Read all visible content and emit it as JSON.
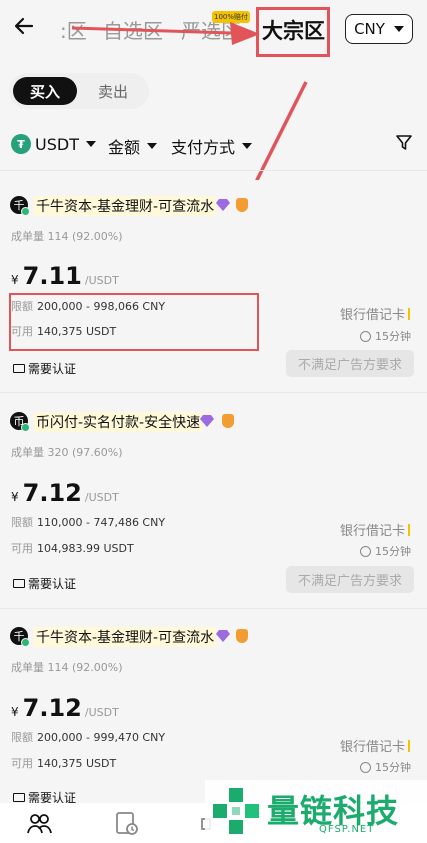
{
  "header": {
    "back_icon": "arrow-left-icon",
    "tabs": [
      {
        "label": ":区",
        "active": false
      },
      {
        "label": "自选区",
        "active": false
      },
      {
        "label": "严选区",
        "active": false
      },
      {
        "label": "大宗区",
        "active": true
      }
    ],
    "badge": "100%赔付",
    "currency": "CNY"
  },
  "trade_toggle": {
    "buy": "买入",
    "sell": "卖出"
  },
  "filters": {
    "coin": "USDT",
    "amount": "金额",
    "payment": "支付方式",
    "filter_icon": "funnel-icon"
  },
  "colors": {
    "accent": "#111111",
    "annotation_red": "#e0545a",
    "online": "#2bb673",
    "usdt": "#26a17b"
  },
  "ads": [
    {
      "avatar_char": "千",
      "merchant": "千牛资本-基金理财-可查流水",
      "stats": "成单量 114 (92.00%)",
      "currency_symbol": "¥",
      "price": "7.11",
      "price_unit": "/USDT",
      "limit_label": "限额",
      "limit": "200,000 - 998,066 CNY",
      "available_label": "可用",
      "available": "140,375 USDT",
      "verify": "需要认证",
      "payment": "银行借记卡",
      "time": "15分钟",
      "action": "不满足广告方要求"
    },
    {
      "avatar_char": "币",
      "merchant": "币闪付-实名付款-安全快速",
      "stats": "成单量 320 (97.60%)",
      "currency_symbol": "¥",
      "price": "7.12",
      "price_unit": "/USDT",
      "limit_label": "限额",
      "limit": "110,000 - 747,486 CNY",
      "available_label": "可用",
      "available": "104,983.99 USDT",
      "verify": "需要认证",
      "payment": "银行借记卡",
      "time": "15分钟",
      "action": "不满足广告方要求"
    },
    {
      "avatar_char": "千",
      "merchant": "千牛资本-基金理财-可查流水",
      "stats": "成单量 114 (92.00%)",
      "currency_symbol": "¥",
      "price": "7.12",
      "price_unit": "/USDT",
      "limit_label": "限额",
      "limit": "200,000 - 999,470 CNY",
      "available_label": "可用",
      "available": "140,375 USDT",
      "verify": "需要认证",
      "payment": "银行借记卡",
      "time": "15分钟",
      "action": ""
    }
  ],
  "watermark": {
    "text": "量链科技",
    "url": "QFSP.NET"
  }
}
